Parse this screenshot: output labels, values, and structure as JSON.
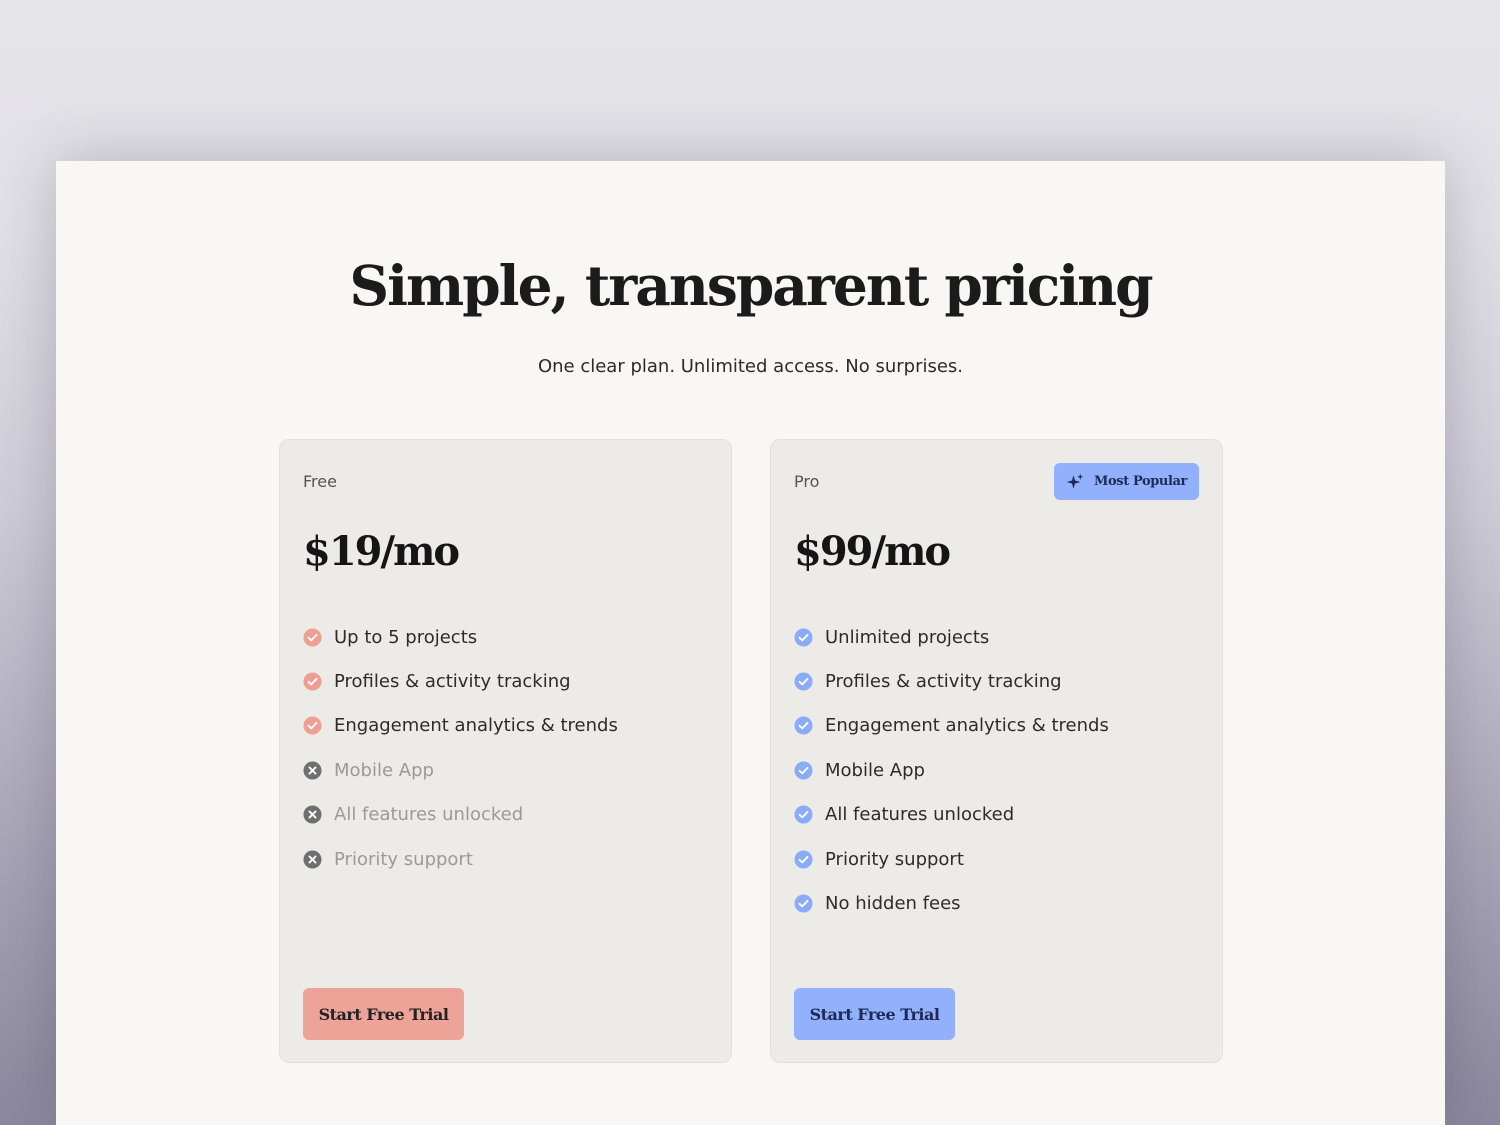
{
  "header": {
    "title": "Simple, transparent pricing",
    "subtitle": "One clear plan. Unlimited access. No surprises."
  },
  "plans": [
    {
      "name": "Free",
      "price": "$19/mo",
      "accent": "#eea398",
      "cta": "Start Free Trial",
      "features": [
        {
          "label": "Up to 5 projects",
          "included": true
        },
        {
          "label": "Profiles & activity tracking",
          "included": true
        },
        {
          "label": "Engagement analytics & trends",
          "included": true
        },
        {
          "label": "Mobile App",
          "included": false
        },
        {
          "label": "All features unlocked",
          "included": false
        },
        {
          "label": "Priority support",
          "included": false
        }
      ]
    },
    {
      "name": "Pro",
      "price": "$99/mo",
      "accent": "#92b0fb",
      "badge": "Most Popular",
      "badge_icon": "sparkles-icon",
      "cta": "Start Free Trial",
      "features": [
        {
          "label": "Unlimited projects",
          "included": true
        },
        {
          "label": "Profiles & activity tracking",
          "included": true
        },
        {
          "label": "Engagement analytics & trends",
          "included": true
        },
        {
          "label": "Mobile App",
          "included": true
        },
        {
          "label": "All features unlocked",
          "included": true
        },
        {
          "label": "Priority support",
          "included": true
        },
        {
          "label": "No hidden fees",
          "included": true
        }
      ]
    }
  ],
  "colors": {
    "included_free": "#ee9e92",
    "included_pro": "#8aabf8",
    "excluded": "#6f6f6f"
  }
}
